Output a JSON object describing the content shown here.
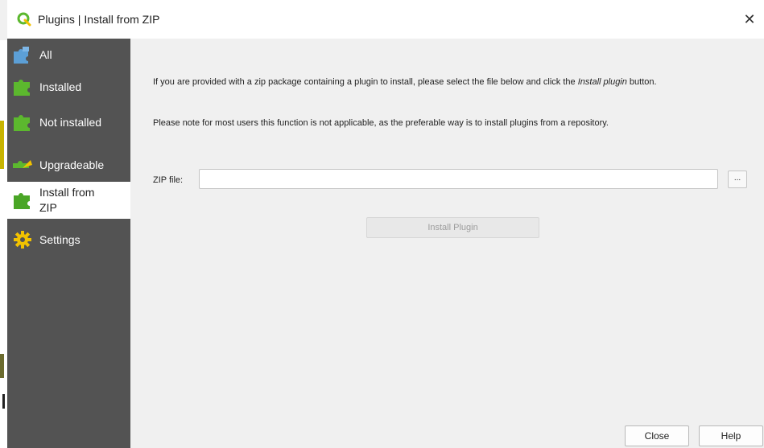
{
  "window": {
    "title": "Plugins | Install from ZIP",
    "close_glyph": "✕",
    "icon": "qgis-logo-icon"
  },
  "sidebar": {
    "items": [
      {
        "label": "All",
        "icon": "puzzle-blue-icon",
        "active": false
      },
      {
        "label": "Installed",
        "icon": "puzzle-green-icon",
        "active": false
      },
      {
        "label": "Not installed",
        "icon": "puzzle-green-icon",
        "active": false
      },
      {
        "label": "Upgradeable",
        "icon": "puzzle-upgrade-icon",
        "active": false
      },
      {
        "label": "Install from",
        "label2": "ZIP",
        "icon": "puzzle-zip-icon",
        "active": true
      },
      {
        "label": "Settings",
        "icon": "gear-icon",
        "active": false
      }
    ]
  },
  "main": {
    "desc1_a": "If you are provided with a zip package containing a plugin to install, please select the file below and click the ",
    "desc1_em": "Install plugin",
    "desc1_b": " button.",
    "desc2": "Please note for most users this function is not applicable, as the preferable way is to install plugins from a repository.",
    "zip_label": "ZIP file:",
    "zip_value": "",
    "browse_label": "...",
    "install_label": "Install Plugin"
  },
  "footer": {
    "close_label": "Close",
    "help_label": "Help"
  },
  "colors": {
    "sidebar_bg": "#535353",
    "active_bg": "#ffffff",
    "dialog_bg": "#f0f0f0",
    "puzzle_green": "#5cb82e",
    "puzzle_blue": "#5c9fd6",
    "gear_yellow": "#f2c200"
  }
}
